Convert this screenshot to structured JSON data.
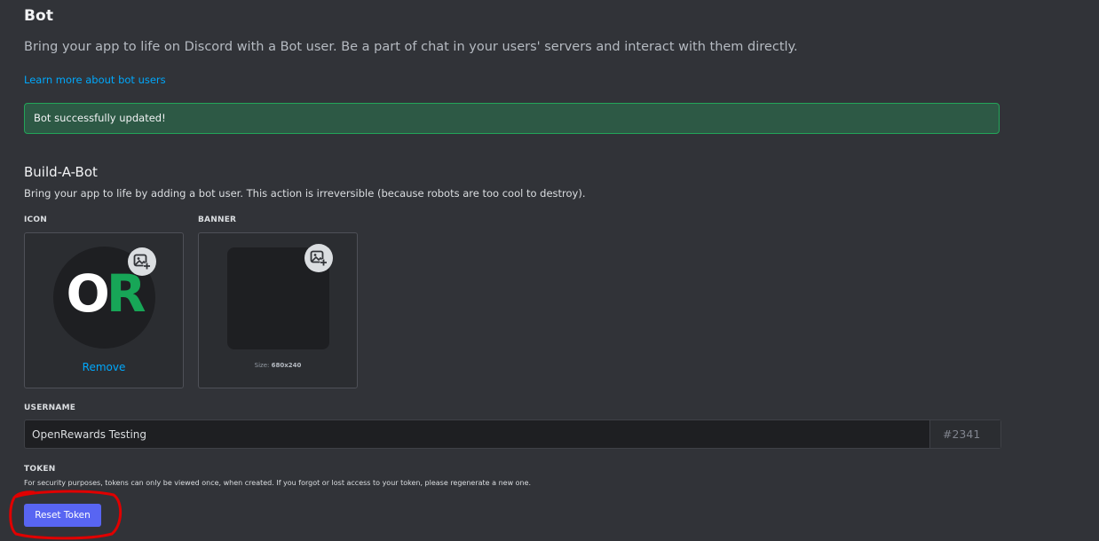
{
  "header": {
    "title": "Bot",
    "subtitle": "Bring your app to life on Discord with a Bot user. Be a part of chat in your users' servers and interact with them directly.",
    "learn_more": "Learn more about bot users"
  },
  "notice": {
    "message": "Bot successfully updated!"
  },
  "build": {
    "title": "Build-A-Bot",
    "description": "Bring your app to life by adding a bot user. This action is irreversible (because robots are too cool to destroy).",
    "icon_label": "ICON",
    "avatar_letters": [
      "O",
      "R"
    ],
    "remove_label": "Remove",
    "banner_label": "BANNER",
    "banner_size_prefix": "Size:",
    "banner_size_value": "680x240"
  },
  "username": {
    "label": "USERNAME",
    "value": "OpenRewards Testing",
    "discriminator": "#2341"
  },
  "token": {
    "label": "TOKEN",
    "description": "For security purposes, tokens can only be viewed once, when created. If you forgot or lost access to your token, please regenerate a new one.",
    "reset_label": "Reset Token"
  },
  "colors": {
    "background": "#313338",
    "accent": "#5865f2",
    "link": "#00a8fc",
    "success_bg": "#2d5945",
    "success_border": "#23a559",
    "annotation": "#e00000"
  },
  "icons": {
    "icon_upload": "image-add-icon",
    "banner_upload": "image-add-icon"
  }
}
